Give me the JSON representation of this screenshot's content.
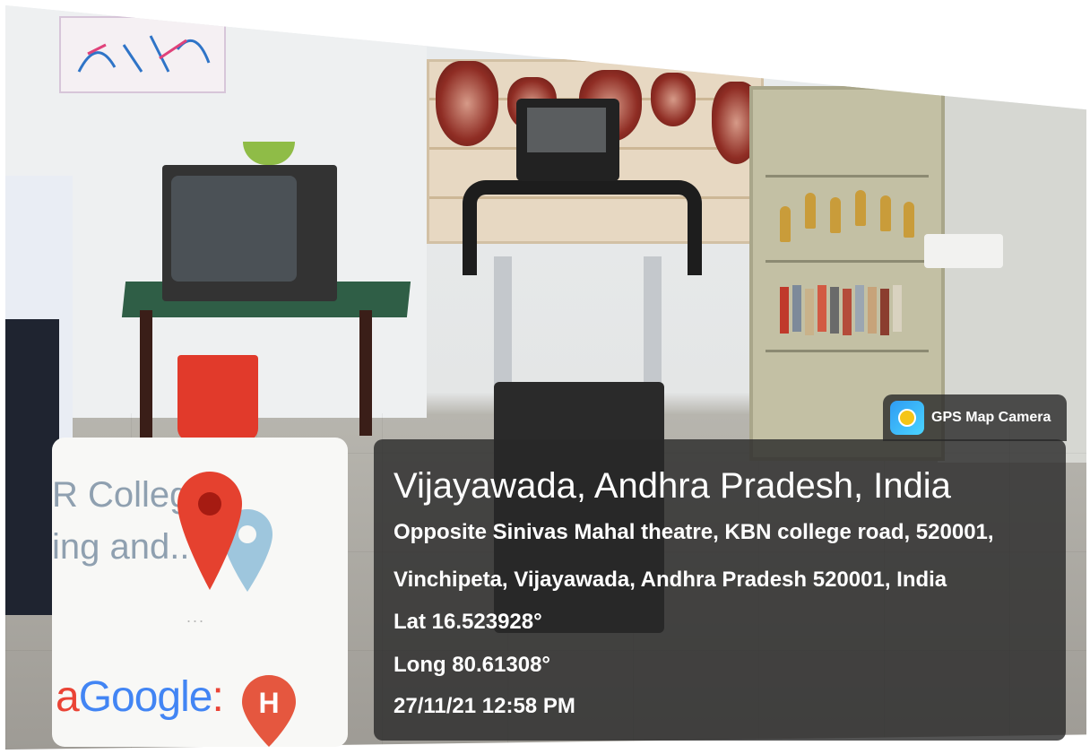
{
  "watermark": {
    "app_name": "GPS Map Camera",
    "place_title": "Vijayawada, Andhra Pradesh, India",
    "address_line_1": "Opposite Sinivas Mahal theatre, KBN college road, 520001,",
    "address_line_2": "Vinchipeta, Vijayawada, Andhra Pradesh 520001, India",
    "latitude": "Lat 16.523928°",
    "longitude": "Long 80.61308°",
    "datetime": "27/11/21 12:58 PM"
  },
  "map_thumbnail": {
    "label_line_1": "R Colleg",
    "label_line_2": "ing and..",
    "ellipsis": "...",
    "google_logo": "Google",
    "hospital_marker": "H"
  },
  "colors": {
    "panel_bg": "#282828",
    "pin_red": "#e5412f",
    "pin_blue": "#9ec6dd",
    "hospital_marker": "#e5573f"
  }
}
